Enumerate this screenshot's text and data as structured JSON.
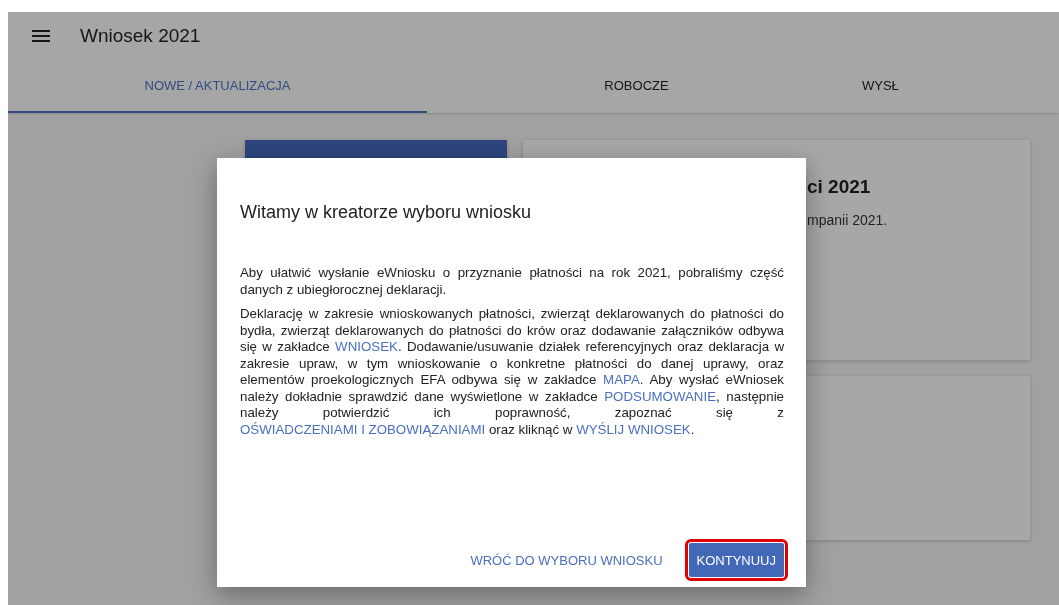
{
  "app_bar": {
    "title": "Wniosek 2021"
  },
  "tabs": [
    {
      "label": "NOWE / AKTUALIZACJA",
      "selected": true
    },
    {
      "label": "ROBOCZE",
      "selected": false
    },
    {
      "label": "WYSŁ",
      "selected": false
    }
  ],
  "cards": [
    {
      "kind": "blue"
    },
    {
      "kind": "info",
      "title": "ci 2021",
      "text": "mpanii 2021."
    },
    {
      "kind": "blank"
    }
  ],
  "dialog": {
    "title": "Witamy w kreatorze wyboru wniosku",
    "paragraphs": [
      [
        {
          "kind": "text",
          "text": "Aby ułatwić wysłanie eWniosku o przyznanie płatności na rok 2021, pobraliśmy część danych z ubiegłorocznej deklaracji."
        }
      ],
      [
        {
          "kind": "text",
          "text": "Deklarację w zakresie wnioskowanych płatności, zwierząt deklarowanych do płatności do bydła, zwierząt deklarowanych do płatności do krów oraz dodawanie załączników odbywa się w zakładce "
        },
        {
          "kind": "link",
          "text": "WNIOSEK"
        },
        {
          "kind": "text",
          "text": ". Dodawanie/usuwanie działek referencyjnych oraz deklaracja w zakresie upraw, w tym wnioskowanie o konkretne płatności do danej uprawy, oraz elementów proekologicznych EFA odbywa się w zakładce "
        },
        {
          "kind": "link",
          "text": "MAPA"
        },
        {
          "kind": "text",
          "text": ". Aby wysłać eWniosek należy dokładnie sprawdzić dane wyświetlone w zakładce "
        },
        {
          "kind": "link",
          "text": "PODSUMOWANIE"
        },
        {
          "kind": "text",
          "text": ", następnie należy potwierdzić ich poprawność, zapoznać się z "
        },
        {
          "kind": "link",
          "text": "OŚWIADCZENIAMI I ZOBOWIĄZANIAMI"
        },
        {
          "kind": "text",
          "text": " oraz kliknąć w "
        },
        {
          "kind": "link",
          "text": "WYŚLIJ WNIOSEK"
        },
        {
          "kind": "text",
          "text": "."
        }
      ]
    ],
    "buttons": [
      {
        "label": "WRÓĆ DO WYBORU WNIOSKU",
        "kind": "text"
      },
      {
        "label": "KONTYNUUJ",
        "kind": "primary",
        "highlighted": true
      }
    ]
  }
}
